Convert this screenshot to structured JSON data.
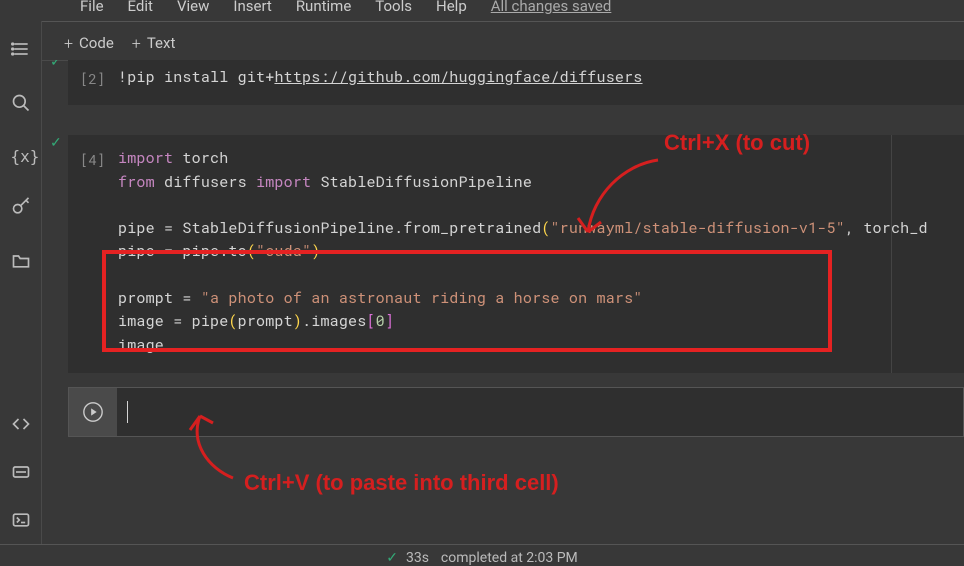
{
  "menubar": {
    "items": [
      "File",
      "Edit",
      "View",
      "Insert",
      "Runtime",
      "Tools",
      "Help"
    ],
    "save_status": "All changes saved"
  },
  "toolbar": {
    "code_label": "Code",
    "text_label": "Text"
  },
  "cells": {
    "c1": {
      "exec": "[2]",
      "line1_a": "!pip install git+",
      "line1_b": "https://github.com/huggingface/diffusers"
    },
    "c2": {
      "exec": "[4]",
      "l1_kw": "import",
      "l1_mod": " torch",
      "l2_from": "from",
      "l2_mod": " diffusers ",
      "l2_import": "import",
      "l2_cls": " StableDiffusionPipeline",
      "l3_a": "pipe = StableDiffusionPipeline.from_pretrained",
      "l3_p1": "(",
      "l3_s": "\"runwayml/stable-diffusion-v1-5\"",
      "l3_b": ", torch_d",
      "l3_p2": "",
      "l4_a": "pipe = pipe.to",
      "l4_p1": "(",
      "l4_s": "\"cuda\"",
      "l4_p2": ")",
      "l5_a": "prompt = ",
      "l5_s": "\"a photo of an astronaut riding a horse on mars\"",
      "l6_a": "image = pipe",
      "l6_p1": "(",
      "l6_b": "prompt",
      "l6_p2": ")",
      "l6_c": ".images",
      "l6_p3": "[",
      "l6_n": "0",
      "l6_p4": "]",
      "l7_a": "image"
    }
  },
  "annotations": {
    "cut": "Ctrl+X (to cut)",
    "paste": "Ctrl+V (to paste into third cell)"
  },
  "statusbar": {
    "tick": "✓",
    "duration": "33s",
    "completed": "completed at 2:03 PM"
  }
}
